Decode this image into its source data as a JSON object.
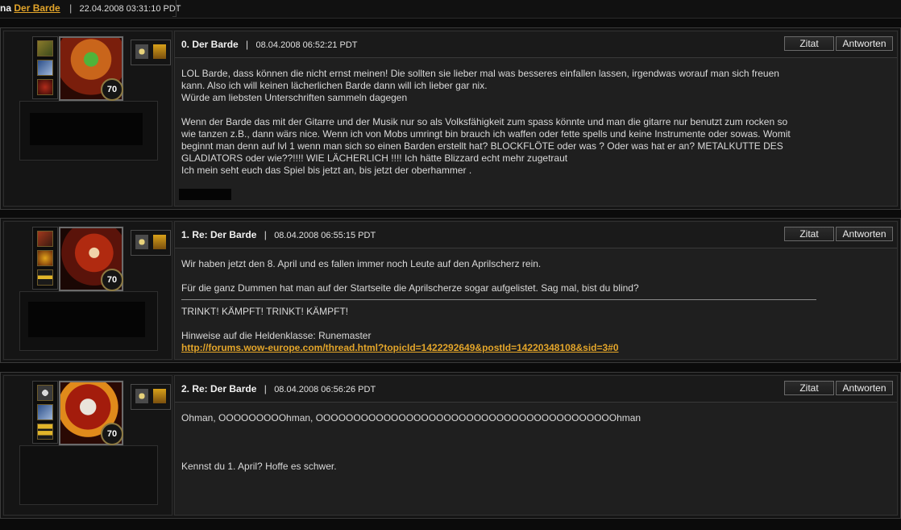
{
  "topbar": {
    "prefix": "na",
    "topic": "Der Barde",
    "separator": "|",
    "datetime": "22.04.2008 03:31:10 PDT"
  },
  "buttons": {
    "quote": "Zitat",
    "reply": "Antworten"
  },
  "posts": [
    {
      "title": "0. Der Barde",
      "separator": "|",
      "timestamp": "08.04.2008 06:52:21 PDT",
      "level": "70",
      "lines": [
        "LOL Barde, dass können die nicht ernst meinen! Die sollten sie lieber mal was besseres einfallen lassen, irgendwas worauf man sich freuen",
        "kann. Also ich will keinen lächerlichen Barde dann will ich lieber gar nix.",
        "Würde am liebsten Unterschriften sammeln dagegen",
        "",
        "Wenn der Barde das mit der Gitarre und der Musik nur so als Volksfähigkeit zum spass könnte und man die gitarre nur benutzt zum rocken so",
        "wie tanzen z.B., dann wärs nice. Wenn ich von Mobs umringt bin brauch ich waffen oder fette spells und keine Instrumente oder sowas. Womit",
        "beginnt man denn auf lvl 1 wenn man sich so einen Barden erstellt hat? BLOCKFLÖTE oder was ? Oder was hat er an? METALKUTTE DES",
        "GLADIATORS oder wie??!!!! WIE LÄCHERLICH !!!! Ich hätte Blizzard echt mehr zugetraut",
        "Ich mein seht euch das Spiel bis jetzt an, bis jetzt der oberhammer ."
      ]
    },
    {
      "title": "1. Re: Der Barde",
      "separator": "|",
      "timestamp": "08.04.2008 06:55:15 PDT",
      "level": "70",
      "lines": [
        "Wir haben jetzt den 8. April und es fallen immer noch Leute auf den Aprilscherz rein.",
        "",
        "Für die ganz Dummen hat man auf der Startseite die Aprilscherze sogar aufgelistet. Sag mal, bist du blind?"
      ],
      "signature": [
        "TRINKT! KÄMPFT! TRINKT! KÄMPFT!",
        "",
        "Hinweise auf die Heldenklasse: Runemaster"
      ],
      "link": "http://forums.wow-europe.com/thread.html?topicId=1422292649&postId=14220348108&sid=3#0"
    },
    {
      "title": "2. Re: Der Barde",
      "separator": "|",
      "timestamp": "08.04.2008 06:56:26 PDT",
      "level": "70",
      "lines": [
        "Ohman, OOOOOOOOOhman, OOOOOOOOOOOOOOOOOOOOOOOOOOOOOOOOOOOOOOOOhman",
        "",
        "",
        "",
        "Kennst du 1. April? Hoffe es schwer."
      ]
    }
  ]
}
